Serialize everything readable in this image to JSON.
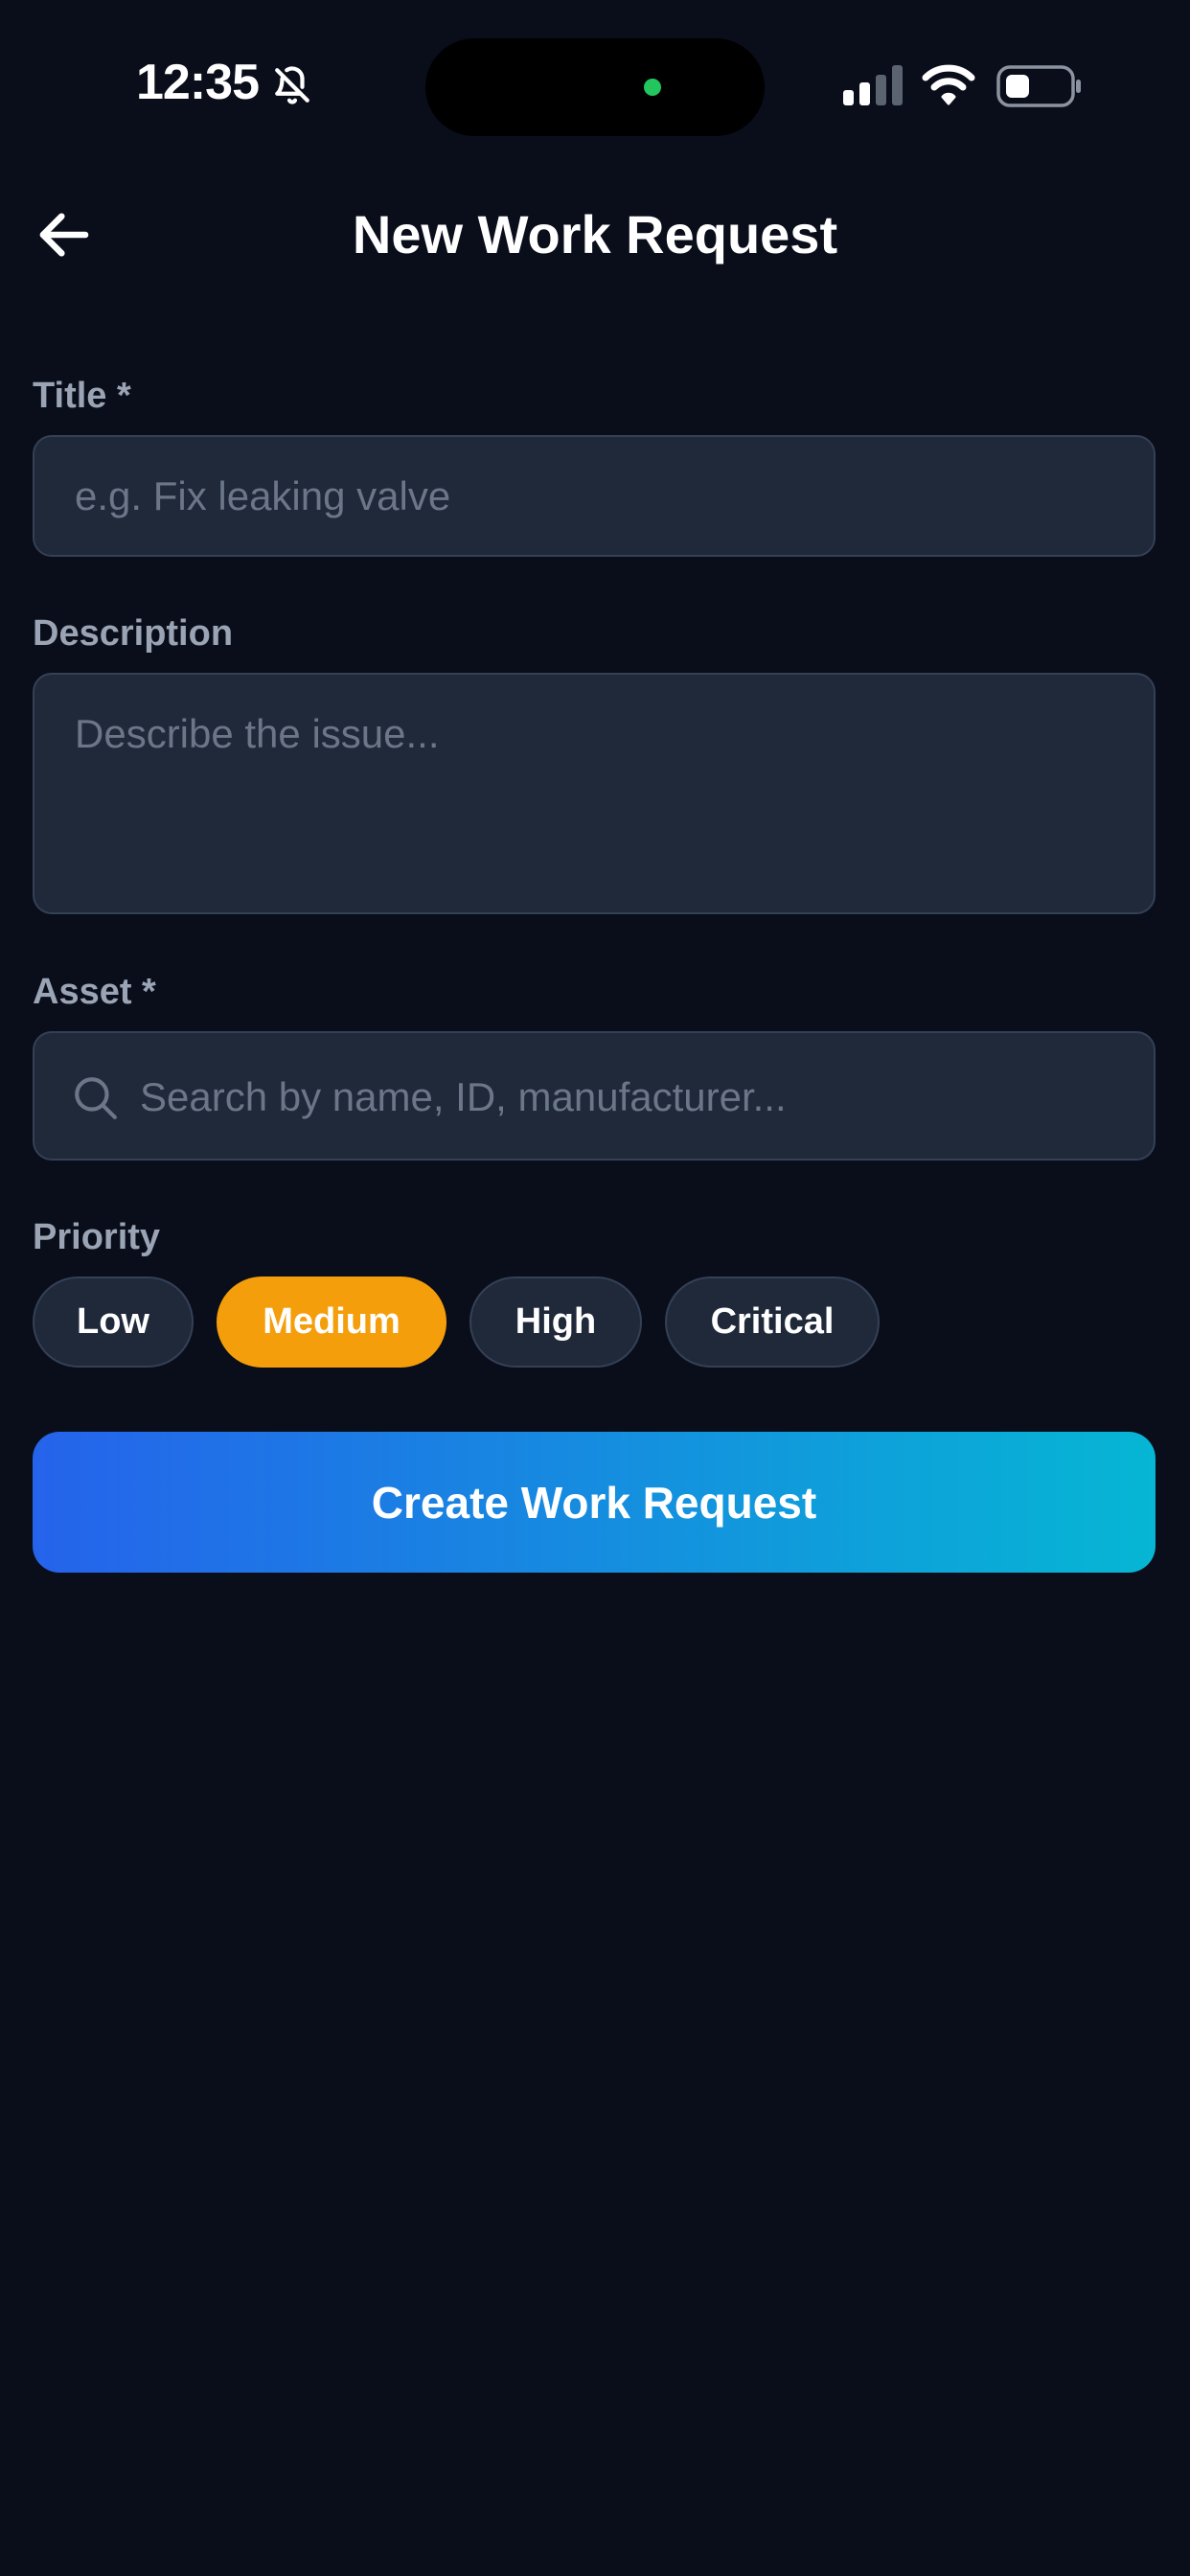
{
  "status_bar": {
    "time": "12:35",
    "icons": [
      "bell-off-icon",
      "signal-icon",
      "wifi-icon",
      "battery-icon"
    ]
  },
  "header": {
    "title": "New Work Request",
    "back_icon": "arrow-left-icon"
  },
  "form": {
    "title_field": {
      "label": "Title *",
      "value": "",
      "placeholder": "e.g. Fix leaking valve"
    },
    "description_field": {
      "label": "Description",
      "value": "",
      "placeholder": "Describe the issue..."
    },
    "asset_field": {
      "label": "Asset *",
      "value": "",
      "placeholder": "Search by name, ID, manufacturer...",
      "icon": "search-icon"
    },
    "priority": {
      "label": "Priority",
      "options": [
        "Low",
        "Medium",
        "High",
        "Critical"
      ],
      "selected": "Medium"
    },
    "submit_label": "Create Work Request"
  },
  "colors": {
    "background": "#0a0e1a",
    "input_background": "#1f293a",
    "input_border": "#344056",
    "label": "#9aa4b5",
    "placeholder": "#6b7689",
    "selected_chip": "#f59e0b",
    "gradient_start": "#2563eb",
    "gradient_end": "#06b6d4",
    "camera_dot": "#22c55e"
  }
}
